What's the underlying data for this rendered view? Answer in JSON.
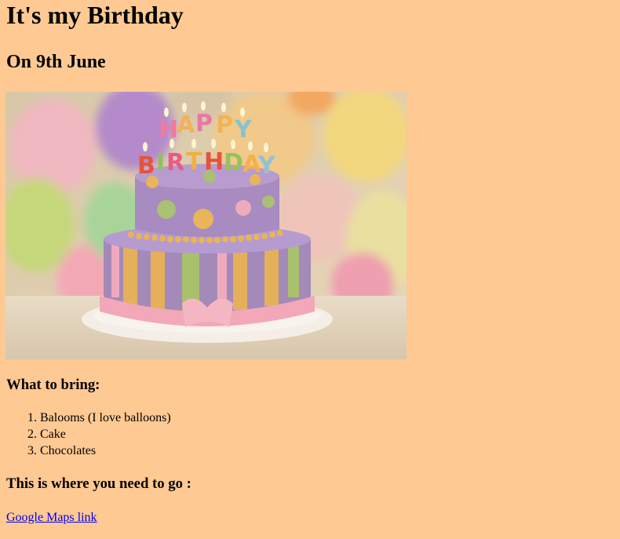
{
  "page": {
    "title": "It's my Birthday",
    "subtitle": "On 9th June",
    "bring_heading": "What to bring:",
    "bring_items": [
      "Balooms (I love balloons)",
      "Cake",
      "Chocolates"
    ],
    "where_heading": "This is where you need to go :",
    "map_link": "Google Maps link",
    "cake_letters_top": [
      "H",
      "A",
      "P",
      "P",
      "Y"
    ],
    "cake_letters_bottom": [
      "B",
      "I",
      "R",
      "T",
      "H",
      "D",
      "A",
      "Y"
    ]
  },
  "colors": {
    "background": "#ffc993",
    "link": "#0000ee"
  }
}
